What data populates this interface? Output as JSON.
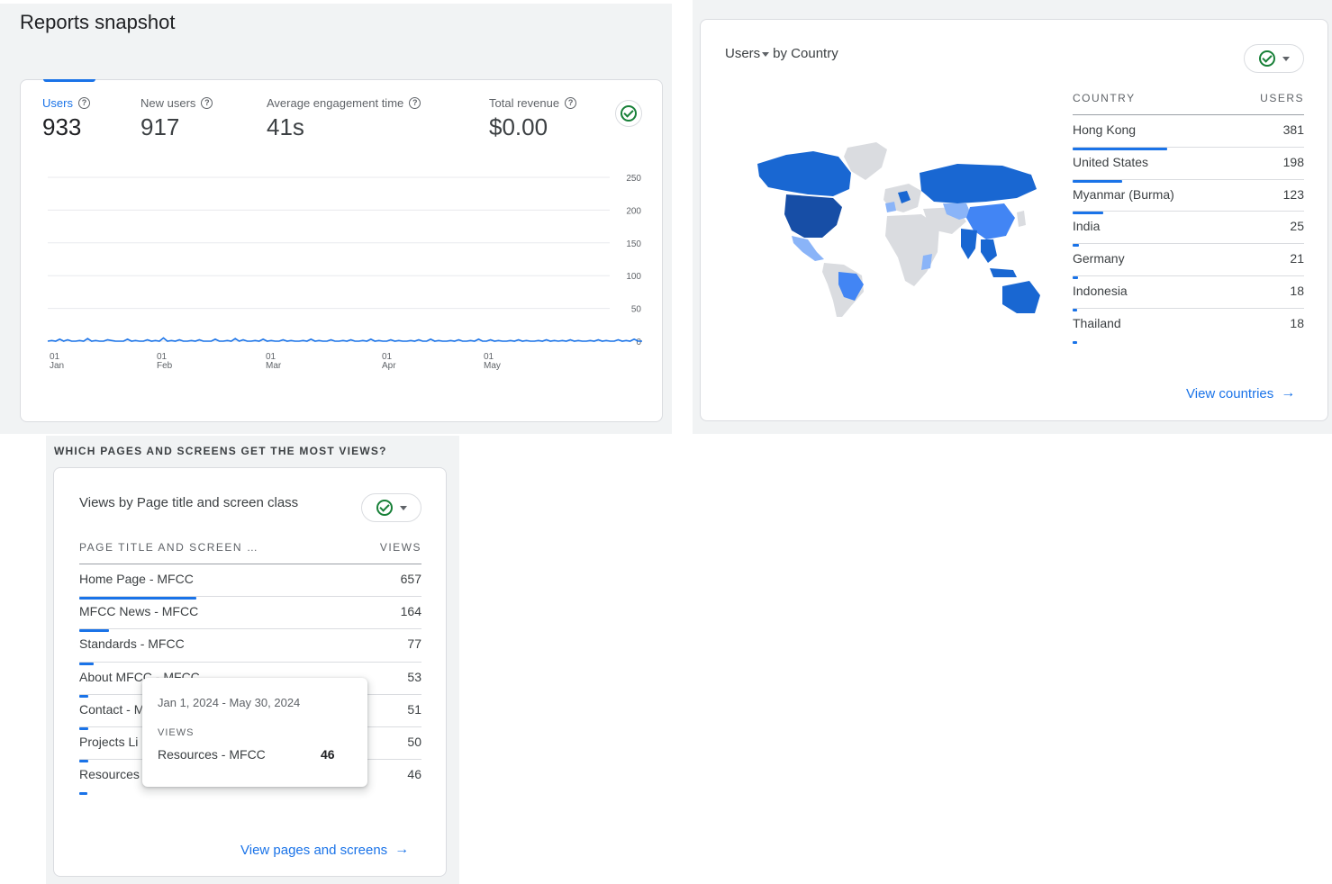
{
  "snapshot": {
    "title": "Reports snapshot",
    "metrics": [
      {
        "label": "Users",
        "value": "933"
      },
      {
        "label": "New users",
        "value": "917"
      },
      {
        "label": "Average engagement time",
        "value": "41s"
      },
      {
        "label": "Total revenue",
        "value": "$0.00"
      }
    ]
  },
  "chart_data": {
    "type": "line",
    "title": "",
    "xlabel": "",
    "ylabel": "",
    "ylim": [
      0,
      250
    ],
    "y_ticks": [
      "250",
      "200",
      "150",
      "100",
      "50",
      "0"
    ],
    "x_ticks": [
      {
        "day": "01",
        "month": "Jan"
      },
      {
        "day": "01",
        "month": "Feb"
      },
      {
        "day": "01",
        "month": "Mar"
      },
      {
        "day": "01",
        "month": "Apr"
      },
      {
        "day": "01",
        "month": "May"
      }
    ],
    "grid": true,
    "series": [
      {
        "color": "#1a73e8",
        "values": [
          0,
          1,
          0,
          3,
          0,
          2,
          0,
          0,
          1,
          0,
          4,
          0,
          1,
          0,
          0,
          2,
          1,
          0,
          0,
          0,
          3,
          0,
          1,
          0,
          0,
          2,
          0,
          1,
          0,
          5,
          0,
          1,
          0,
          2,
          0,
          0,
          1,
          0,
          2,
          0,
          0,
          0,
          3,
          0,
          0,
          1,
          0,
          4,
          0,
          2,
          0,
          0,
          1,
          0,
          3,
          0,
          1,
          0,
          0,
          2,
          0,
          1,
          0,
          0,
          1,
          0,
          3,
          0,
          1,
          0,
          0,
          2,
          0,
          0,
          1,
          0,
          2,
          0,
          0,
          1,
          0,
          3,
          0,
          1,
          0,
          0,
          2,
          0,
          1,
          0,
          0,
          1,
          0,
          2,
          0,
          0,
          3,
          0,
          1,
          0,
          0,
          1,
          0,
          2,
          0,
          0,
          1,
          0,
          3,
          0,
          0,
          2,
          0,
          1,
          0,
          0,
          1,
          0,
          2,
          0,
          1,
          0,
          0,
          1,
          0,
          2,
          0,
          1,
          0,
          1,
          0,
          2,
          0,
          1,
          0,
          0,
          1,
          0,
          2,
          0,
          1,
          0,
          0,
          2,
          0,
          1,
          0,
          3,
          0,
          0
        ]
      }
    ]
  },
  "country": {
    "title_metric": "Users",
    "title_rest": "by Country",
    "col_dim": "COUNTRY",
    "col_val": "USERS",
    "rows": [
      {
        "name": "Hong Kong",
        "value": "381",
        "frac": 1.0
      },
      {
        "name": "United States",
        "value": "198",
        "frac": 0.52
      },
      {
        "name": "Myanmar (Burma)",
        "value": "123",
        "frac": 0.32
      },
      {
        "name": "India",
        "value": "25",
        "frac": 0.066
      },
      {
        "name": "Germany",
        "value": "21",
        "frac": 0.055
      },
      {
        "name": "Indonesia",
        "value": "18",
        "frac": 0.047
      },
      {
        "name": "Thailand",
        "value": "18",
        "frac": 0.047
      }
    ],
    "link": "View countries"
  },
  "pages": {
    "heading": "WHICH PAGES AND SCREENS GET THE MOST VIEWS?",
    "title": "Views by Page title and screen class",
    "col_dim": "PAGE TITLE AND SCREEN …",
    "col_val": "VIEWS",
    "rows": [
      {
        "name": "Home Page - MFCC",
        "value": "657",
        "frac": 1.0
      },
      {
        "name": "MFCC News - MFCC",
        "value": "164",
        "frac": 0.25
      },
      {
        "name": "Standards - MFCC",
        "value": "77",
        "frac": 0.12
      },
      {
        "name": "About MFCC - MFCC",
        "value": "53",
        "frac": 0.08
      },
      {
        "name": "Contact - M",
        "value": "51",
        "frac": 0.078
      },
      {
        "name": "Projects Li",
        "value": "50",
        "frac": 0.076
      },
      {
        "name": "Resources",
        "value": "46",
        "frac": 0.07
      }
    ],
    "link": "View pages and screens",
    "tooltip": {
      "date_range": "Jan 1, 2024 - May 30, 2024",
      "metric": "VIEWS",
      "name": "Resources - MFCC",
      "value": "46"
    }
  },
  "colors": {
    "accent": "#1a73e8",
    "check": "#188038",
    "map_dark": "#174ea6",
    "map_mid": "#1967d2",
    "map_light": "#4285f4",
    "map_pale": "#8ab4f8",
    "map_none": "#dadce0"
  }
}
